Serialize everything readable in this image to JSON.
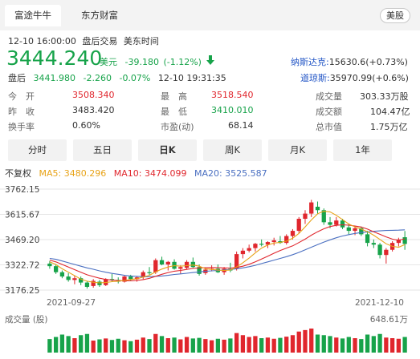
{
  "tabs": [
    {
      "label": "富途牛牛",
      "active": true
    },
    {
      "label": "东方财富",
      "active": false
    }
  ],
  "region_button": "美股",
  "timestamp": "12-10 16:00:00",
  "session": "盘后交易",
  "timezone": "美东时间",
  "price": "3444.240",
  "currency": "美元",
  "change": "-39.180",
  "change_pct": "(-1.12%)",
  "arrow": "down",
  "after_hours": {
    "label": "盘后",
    "price": "3441.980",
    "change": "-2.260",
    "pct": "-0.07%",
    "time": "12-10 19:31:35"
  },
  "indices": [
    {
      "name": "纳斯达克:",
      "value": "15630.6(+0.73%)"
    },
    {
      "name": "道琼斯:",
      "value": "35970.99(+0.6%)"
    }
  ],
  "stats": {
    "open_label": "今　开",
    "open": "3508.340",
    "prev_label": "昨　收",
    "prev": "3483.420",
    "turnover_label": "换手率",
    "turnover": "0.60%",
    "high_label": "最　高",
    "high": "3518.540",
    "low_label": "最　低",
    "low": "3410.010",
    "pe_label": "市盈(动)",
    "pe": "68.14",
    "volume_label": "成交量",
    "volume": "303.33万股",
    "amount_label": "成交额",
    "amount": "104.47亿",
    "mcap_label": "总市值",
    "mcap": "1.75万亿"
  },
  "period_tabs": [
    "分时",
    "五日",
    "日K",
    "周K",
    "月K",
    "1年"
  ],
  "period_active": "日K",
  "ma": {
    "adjust": "不复权",
    "ma5_label": "MA5:",
    "ma5": "3480.296",
    "ma10_label": "MA10:",
    "ma10": "3474.099",
    "ma20_label": "MA20:",
    "ma20": "3525.587"
  },
  "colors": {
    "up": "#e0262d",
    "down": "#17a34a",
    "ma5": "#e8a317",
    "ma10": "#e0262d",
    "ma20": "#4a6fc1",
    "tab_bg": "#f2f2f2"
  },
  "volume_label": "成交量 (股)",
  "volume_max": "648.61万",
  "chart_data": {
    "type": "candlestick",
    "y_ticks": [
      "3762.15",
      "3615.67",
      "3469.20",
      "3322.72",
      "3176.25"
    ],
    "ylim": [
      3176.25,
      3762.15
    ],
    "x_labels": [
      "2021-09-27",
      "2021-12-10"
    ],
    "grid": true,
    "candles": [
      {
        "o": 3330,
        "h": 3345,
        "l": 3300,
        "c": 3315
      },
      {
        "o": 3315,
        "h": 3325,
        "l": 3270,
        "c": 3280
      },
      {
        "o": 3280,
        "h": 3290,
        "l": 3245,
        "c": 3255
      },
      {
        "o": 3255,
        "h": 3275,
        "l": 3225,
        "c": 3235
      },
      {
        "o": 3235,
        "h": 3260,
        "l": 3210,
        "c": 3245
      },
      {
        "o": 3245,
        "h": 3255,
        "l": 3205,
        "c": 3220
      },
      {
        "o": 3220,
        "h": 3230,
        "l": 3185,
        "c": 3195
      },
      {
        "o": 3200,
        "h": 3240,
        "l": 3190,
        "c": 3230
      },
      {
        "o": 3225,
        "h": 3235,
        "l": 3195,
        "c": 3205
      },
      {
        "o": 3205,
        "h": 3245,
        "l": 3200,
        "c": 3240
      },
      {
        "o": 3240,
        "h": 3270,
        "l": 3225,
        "c": 3235
      },
      {
        "o": 3235,
        "h": 3250,
        "l": 3215,
        "c": 3225
      },
      {
        "o": 3225,
        "h": 3260,
        "l": 3220,
        "c": 3255
      },
      {
        "o": 3255,
        "h": 3265,
        "l": 3230,
        "c": 3240
      },
      {
        "o": 3240,
        "h": 3255,
        "l": 3225,
        "c": 3250
      },
      {
        "o": 3250,
        "h": 3290,
        "l": 3240,
        "c": 3280
      },
      {
        "o": 3280,
        "h": 3310,
        "l": 3265,
        "c": 3275
      },
      {
        "o": 3280,
        "h": 3360,
        "l": 3270,
        "c": 3350
      },
      {
        "o": 3350,
        "h": 3370,
        "l": 3320,
        "c": 3325
      },
      {
        "o": 3325,
        "h": 3345,
        "l": 3290,
        "c": 3340
      },
      {
        "o": 3340,
        "h": 3355,
        "l": 3295,
        "c": 3300
      },
      {
        "o": 3300,
        "h": 3320,
        "l": 3270,
        "c": 3310
      },
      {
        "o": 3305,
        "h": 3350,
        "l": 3295,
        "c": 3340
      },
      {
        "o": 3340,
        "h": 3365,
        "l": 3305,
        "c": 3310
      },
      {
        "o": 3310,
        "h": 3325,
        "l": 3260,
        "c": 3270
      },
      {
        "o": 3275,
        "h": 3305,
        "l": 3265,
        "c": 3295
      },
      {
        "o": 3295,
        "h": 3320,
        "l": 3285,
        "c": 3300
      },
      {
        "o": 3300,
        "h": 3325,
        "l": 3275,
        "c": 3280
      },
      {
        "o": 3280,
        "h": 3310,
        "l": 3265,
        "c": 3300
      },
      {
        "o": 3300,
        "h": 3335,
        "l": 3280,
        "c": 3290
      },
      {
        "o": 3300,
        "h": 3400,
        "l": 3290,
        "c": 3385
      },
      {
        "o": 3385,
        "h": 3420,
        "l": 3360,
        "c": 3405
      },
      {
        "o": 3405,
        "h": 3440,
        "l": 3395,
        "c": 3420
      },
      {
        "o": 3420,
        "h": 3450,
        "l": 3400,
        "c": 3445
      },
      {
        "o": 3445,
        "h": 3470,
        "l": 3430,
        "c": 3440
      },
      {
        "o": 3440,
        "h": 3460,
        "l": 3420,
        "c": 3455
      },
      {
        "o": 3455,
        "h": 3480,
        "l": 3435,
        "c": 3465
      },
      {
        "o": 3460,
        "h": 3490,
        "l": 3445,
        "c": 3450
      },
      {
        "o": 3450,
        "h": 3500,
        "l": 3440,
        "c": 3490
      },
      {
        "o": 3490,
        "h": 3530,
        "l": 3470,
        "c": 3520
      },
      {
        "o": 3520,
        "h": 3600,
        "l": 3505,
        "c": 3590
      },
      {
        "o": 3590,
        "h": 3640,
        "l": 3560,
        "c": 3620
      },
      {
        "o": 3620,
        "h": 3700,
        "l": 3600,
        "c": 3685
      },
      {
        "o": 3660,
        "h": 3690,
        "l": 3620,
        "c": 3640
      },
      {
        "o": 3640,
        "h": 3650,
        "l": 3555,
        "c": 3570
      },
      {
        "o": 3570,
        "h": 3600,
        "l": 3535,
        "c": 3555
      },
      {
        "o": 3555,
        "h": 3600,
        "l": 3545,
        "c": 3580
      },
      {
        "o": 3580,
        "h": 3590,
        "l": 3530,
        "c": 3540
      },
      {
        "o": 3540,
        "h": 3560,
        "l": 3500,
        "c": 3520
      },
      {
        "o": 3520,
        "h": 3550,
        "l": 3495,
        "c": 3535
      },
      {
        "o": 3535,
        "h": 3545,
        "l": 3490,
        "c": 3500
      },
      {
        "o": 3500,
        "h": 3520,
        "l": 3430,
        "c": 3450
      },
      {
        "o": 3450,
        "h": 3470,
        "l": 3420,
        "c": 3440
      },
      {
        "o": 3440,
        "h": 3450,
        "l": 3360,
        "c": 3380
      },
      {
        "o": 3380,
        "h": 3420,
        "l": 3330,
        "c": 3410
      },
      {
        "o": 3410,
        "h": 3460,
        "l": 3400,
        "c": 3450
      },
      {
        "o": 3450,
        "h": 3480,
        "l": 3430,
        "c": 3470
      },
      {
        "o": 3483,
        "h": 3519,
        "l": 3410,
        "c": 3444
      }
    ],
    "ma5": [
      3340,
      3325,
      3300,
      3280,
      3260,
      3240,
      3228,
      3222,
      3218,
      3220,
      3225,
      3228,
      3232,
      3238,
      3242,
      3252,
      3262,
      3282,
      3298,
      3310,
      3318,
      3315,
      3318,
      3322,
      3315,
      3300,
      3296,
      3292,
      3290,
      3293,
      3310,
      3335,
      3362,
      3392,
      3420,
      3438,
      3449,
      3453,
      3460,
      3477,
      3505,
      3543,
      3583,
      3619,
      3634,
      3630,
      3610,
      3585,
      3560,
      3542,
      3530,
      3515,
      3495,
      3470,
      3445,
      3430,
      3425,
      3440
    ],
    "ma10": [
      3350,
      3340,
      3325,
      3310,
      3295,
      3280,
      3265,
      3255,
      3245,
      3238,
      3234,
      3232,
      3230,
      3230,
      3232,
      3237,
      3244,
      3256,
      3268,
      3278,
      3286,
      3290,
      3296,
      3302,
      3305,
      3306,
      3307,
      3306,
      3305,
      3304,
      3308,
      3315,
      3326,
      3340,
      3356,
      3373,
      3390,
      3406,
      3420,
      3433,
      3452,
      3472,
      3495,
      3515,
      3532,
      3545,
      3552,
      3555,
      3553,
      3548,
      3542,
      3530,
      3515,
      3500,
      3485,
      3472,
      3465,
      3474
    ],
    "ma20": [
      3360,
      3355,
      3345,
      3335,
      3325,
      3315,
      3305,
      3297,
      3288,
      3280,
      3273,
      3268,
      3262,
      3258,
      3256,
      3254,
      3254,
      3256,
      3258,
      3262,
      3267,
      3270,
      3274,
      3278,
      3282,
      3285,
      3288,
      3290,
      3293,
      3296,
      3300,
      3305,
      3312,
      3320,
      3330,
      3340,
      3350,
      3360,
      3370,
      3382,
      3395,
      3410,
      3425,
      3440,
      3455,
      3468,
      3480,
      3490,
      3498,
      3505,
      3510,
      3514,
      3517,
      3520,
      3522,
      3523,
      3524,
      3526
    ],
    "volume": [
      45,
      52,
      60,
      55,
      48,
      58,
      62,
      40,
      44,
      47,
      42,
      46,
      41,
      38,
      43,
      50,
      45,
      62,
      55,
      48,
      50,
      44,
      52,
      47,
      49,
      45,
      41,
      46,
      43,
      47,
      65,
      58,
      52,
      55,
      48,
      50,
      46,
      49,
      53,
      58,
      70,
      75,
      80,
      60,
      58,
      55,
      50,
      47,
      52,
      48,
      45,
      60,
      55,
      62,
      50,
      48,
      46,
      52
    ],
    "volume_up": [
      false,
      false,
      false,
      false,
      true,
      false,
      false,
      true,
      false,
      true,
      false,
      false,
      true,
      false,
      true,
      true,
      false,
      true,
      false,
      true,
      false,
      true,
      true,
      false,
      false,
      true,
      true,
      false,
      true,
      false,
      true,
      true,
      true,
      true,
      false,
      true,
      true,
      false,
      true,
      true,
      true,
      true,
      true,
      false,
      false,
      false,
      true,
      false,
      false,
      true,
      false,
      false,
      false,
      false,
      true,
      true,
      true,
      false
    ]
  }
}
